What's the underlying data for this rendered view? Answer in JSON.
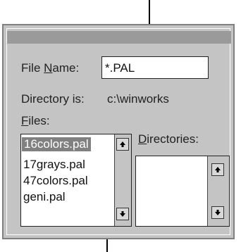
{
  "dialog": {
    "file_name_label": "File Name:",
    "file_name_value": "*.PAL",
    "directory_label": "Directory is:",
    "directory_value": "c:\\winworks",
    "files_label": "Files:",
    "directories_label": "Directories:"
  },
  "files": [
    "16colors.pal",
    "17grays.pal",
    "47colors.pal",
    "geni.pal"
  ],
  "selected_file": "16colors.pal",
  "icons": [
    "scroll-up-arrow-icon",
    "scroll-down-arrow-icon"
  ],
  "colors": {
    "dialog_bg": "#c4c4c4",
    "titlebar": "#9a9a9a",
    "selection": "#808080"
  }
}
